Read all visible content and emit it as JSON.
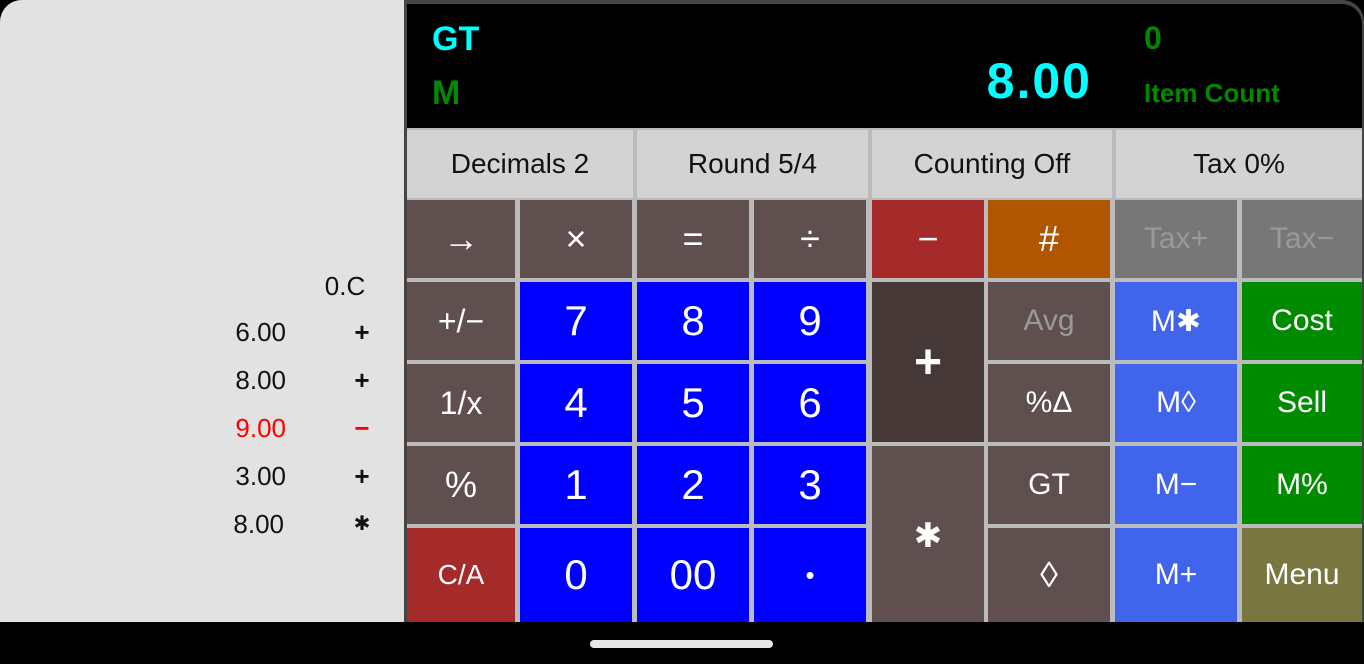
{
  "tape": {
    "header": "0.C",
    "rows": [
      {
        "value": "6.00",
        "op": "+",
        "negative": false
      },
      {
        "value": "8.00",
        "op": "+",
        "negative": false
      },
      {
        "value": "9.00",
        "op": "−",
        "negative": true
      },
      {
        "value": "3.00",
        "op": "+",
        "negative": false
      },
      {
        "value": "8.00",
        "op": "✱",
        "negative": false
      }
    ]
  },
  "display": {
    "gt_indicator": "GT",
    "memory_indicator": "M",
    "value": "8.00",
    "item_count": "0",
    "item_count_label": "Item Count"
  },
  "settings": {
    "decimals": "Decimals 2",
    "rounding": "Round 5/4",
    "counting": "Counting Off",
    "tax": "Tax 0%"
  },
  "keys": {
    "row1": [
      "→",
      "×",
      "=",
      "÷",
      "−",
      "#",
      "Tax+",
      "Tax−"
    ],
    "plus_minus": "+/−",
    "reciprocal": "1/x",
    "percent": "%",
    "clear_all": "C/A",
    "digits": [
      "7",
      "8",
      "9",
      "4",
      "5",
      "6",
      "1",
      "2",
      "3",
      "0",
      "00",
      "•"
    ],
    "plus": "+",
    "total": "✱",
    "avg": "Avg",
    "percent_change": "%Δ",
    "grand_total": "GT",
    "subtotal": "◊",
    "mem_total": "M✱",
    "mem_subtotal": "M◊",
    "mem_minus": "M−",
    "mem_plus": "M+",
    "cost": "Cost",
    "sell": "Sell",
    "margin": "M%",
    "menu": "Menu"
  },
  "colors": {
    "display_primary": "#00ffff",
    "display_secondary": "#008800",
    "digit_key": "#0000ff",
    "memory_key": "#4164ec",
    "green_key": "#008b00",
    "clear_key": "#a52a2a",
    "count_key": "#b05600",
    "negative_tape": "#ff0000"
  }
}
